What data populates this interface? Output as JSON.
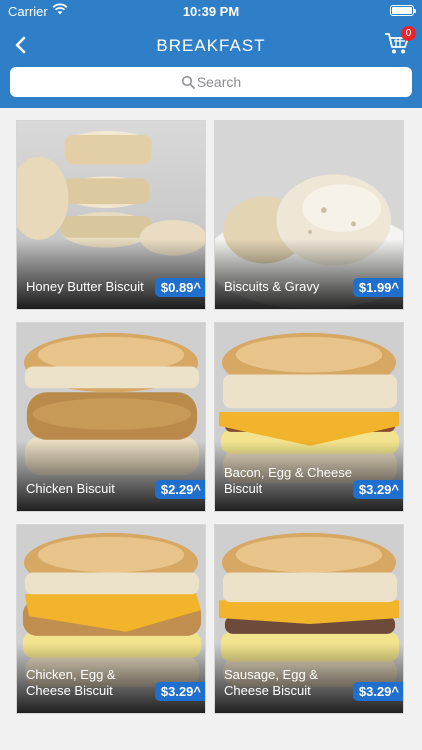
{
  "status_bar": {
    "carrier": "Carrier",
    "time": "10:39 PM"
  },
  "header": {
    "title": "BREAKFAST",
    "cart_count": "0"
  },
  "search": {
    "placeholder": "Search"
  },
  "items": [
    {
      "name": "Honey Butter Biscuit",
      "price": "$0.89^"
    },
    {
      "name": "Biscuits & Gravy",
      "price": "$1.99^"
    },
    {
      "name": "Chicken Biscuit",
      "price": "$2.29^"
    },
    {
      "name": "Bacon, Egg & Cheese Biscuit",
      "price": "$3.29^"
    },
    {
      "name": "Chicken, Egg & Cheese Biscuit",
      "price": "$3.29^"
    },
    {
      "name": "Sausage, Egg & Cheese Biscuit",
      "price": "$3.29^"
    }
  ],
  "colors": {
    "header": "#2f7fc8",
    "price_badge": "#1f6fcf",
    "cart_badge": "#e8262a"
  }
}
